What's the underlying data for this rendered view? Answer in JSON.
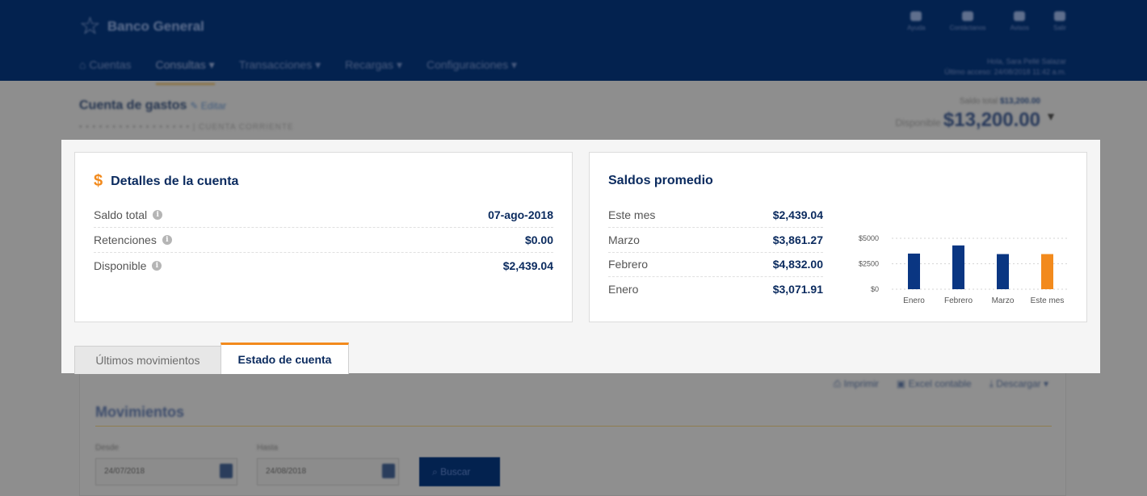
{
  "header": {
    "brand": "Banco General",
    "nav": [
      "Cuentas",
      "Consultas ▾",
      "Transacciones ▾",
      "Recargas ▾",
      "Configuraciones ▾"
    ],
    "icons": [
      {
        "label": "Ayuda",
        "icon": "help-icon"
      },
      {
        "label": "Contáctanos",
        "icon": "chat-icon"
      },
      {
        "label": "Avisos",
        "icon": "bell-icon"
      },
      {
        "label": "Salir",
        "icon": "logout-icon"
      }
    ],
    "user_line1": "Hola, Sara Pellé Salazar",
    "user_line2": "Último acceso: 24/08/2018 11:42 a.m."
  },
  "account": {
    "name": "Cuenta de gastos",
    "edit": "Editar",
    "number_masked": "• • • • • • • • • • • • • • • • •",
    "type": "CUENTA CORRIENTE",
    "saldo_total_label": "Saldo total",
    "saldo_total": "$13,200.00",
    "disponible_label": "Disponible",
    "disponible": "$13,200.00"
  },
  "details_card": {
    "title": "Detalles de la cuenta",
    "rows": [
      {
        "label": "Saldo total",
        "value": "07-ago-2018"
      },
      {
        "label": "Retenciones",
        "value": "$0.00"
      },
      {
        "label": "Disponible",
        "value": "$2,439.04"
      }
    ]
  },
  "avg_card": {
    "title": "Saldos promedio",
    "rows": [
      {
        "label": "Este mes",
        "value": "$2,439.04"
      },
      {
        "label": "Marzo",
        "value": "$3,861.27"
      },
      {
        "label": "Febrero",
        "value": "$4,832.00"
      },
      {
        "label": "Enero",
        "value": "$3,071.91"
      }
    ]
  },
  "chart_data": {
    "type": "bar",
    "categories": [
      "Enero",
      "Febrero",
      "Marzo",
      "Este mes"
    ],
    "values": [
      3500,
      4300,
      3450,
      3450
    ],
    "colors": [
      "#0a3682",
      "#0a3682",
      "#0a3682",
      "#f28a1d"
    ],
    "yticks": [
      "$0",
      "$2500",
      "$5000"
    ],
    "ylim": [
      0,
      5000
    ],
    "grid": true
  },
  "tabs": {
    "movimientos": "Últimos movimientos",
    "estado": "Estado de cuenta"
  },
  "lower": {
    "actions": [
      "Imprimir",
      "Excel contable",
      "Descargar ▾"
    ],
    "section_title": "Movimientos",
    "desde_label": "Desde",
    "desde_value": "24/07/2018",
    "hasta_label": "Hasta",
    "hasta_value": "24/08/2018",
    "search_button": "Buscar"
  },
  "colors": {
    "primary": "#0a2a5e",
    "accent": "#f28a1d",
    "navbar": "#03224f"
  }
}
